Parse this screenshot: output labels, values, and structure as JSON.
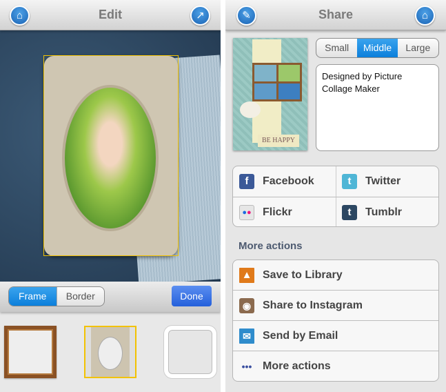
{
  "edit": {
    "title": "Edit",
    "home_icon": "home-icon",
    "share_icon": "share-icon",
    "tabs": [
      {
        "label": "Frame",
        "selected": true
      },
      {
        "label": "Border",
        "selected": false
      }
    ],
    "done_label": "Done",
    "thumbnails": [
      {
        "name": "wood-frame"
      },
      {
        "name": "oval-mat-frame",
        "selected": true
      },
      {
        "name": "white-rounded-frame"
      }
    ]
  },
  "share": {
    "title": "Share",
    "edit_icon": "edit-icon",
    "home_icon": "home-icon",
    "preview_caption": "BE HAPPY",
    "sizes": [
      {
        "label": "Small"
      },
      {
        "label": "Middle",
        "selected": true
      },
      {
        "label": "Large"
      }
    ],
    "description": "Designed by Picture Collage Maker",
    "social": [
      {
        "label": "Facebook",
        "icon": "facebook-icon",
        "color": "#3b5998"
      },
      {
        "label": "Twitter",
        "icon": "twitter-icon",
        "color": "#4fb6d6"
      },
      {
        "label": "Flickr",
        "icon": "flickr-icon",
        "color": "#e6e6e6"
      },
      {
        "label": "Tumblr",
        "icon": "tumblr-icon",
        "color": "#2c4762"
      }
    ],
    "more_header": "More actions",
    "actions": [
      {
        "label": "Save to Library",
        "icon": "photo-library-icon"
      },
      {
        "label": "Share to Instagram",
        "icon": "instagram-icon"
      },
      {
        "label": "Send by Email",
        "icon": "email-icon"
      },
      {
        "label": "More actions",
        "icon": "more-dots-icon"
      }
    ]
  },
  "colors": {
    "accent": "#0c7fdb",
    "selection": "#f2c200",
    "done": "#2460db"
  }
}
